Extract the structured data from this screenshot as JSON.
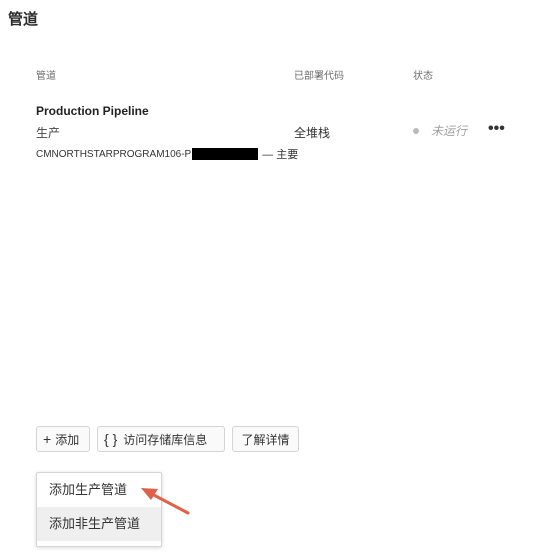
{
  "page": {
    "title": "管道"
  },
  "columns": {
    "pipeline": "管道",
    "deployed": "已部署代码",
    "status": "状态"
  },
  "pipeline_row": {
    "name": "Production Pipeline",
    "environment": "生产",
    "repo_prefix": "CMNORTHSTARPROGRAM106-P",
    "branch": "— 主要",
    "deployed": "全堆栈",
    "status": "未运行",
    "more": "•••"
  },
  "actions": {
    "add": {
      "icon": "plus-icon",
      "label": "添加"
    },
    "repo_info": {
      "icon": "braces-icon",
      "label": "访问存储库信息"
    },
    "learn_more": {
      "label": "了解详情"
    }
  },
  "menu": {
    "items": [
      "添加生产管道",
      "添加非生产管道"
    ]
  },
  "colors": {
    "annotation_arrow": "#e0614a",
    "status_dot": "#b9b9b9"
  }
}
